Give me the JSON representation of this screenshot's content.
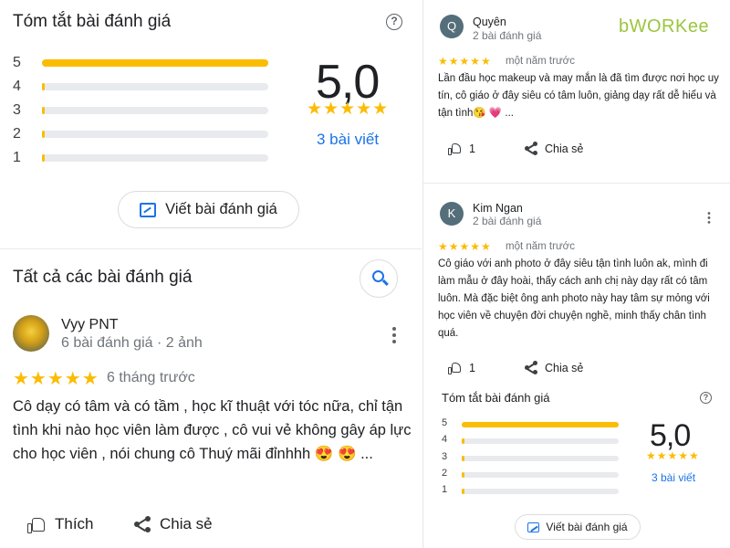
{
  "left": {
    "summary": {
      "title": "Tóm tắt bài đánh giá",
      "bars": [
        {
          "label": "5",
          "fraction": 1.0
        },
        {
          "label": "4",
          "fraction": 0.0
        },
        {
          "label": "3",
          "fraction": 0.0
        },
        {
          "label": "2",
          "fraction": 0.0
        },
        {
          "label": "1",
          "fraction": 0.0
        }
      ],
      "score": "5,0",
      "stars": "★★★★★",
      "count": "3 bài viết",
      "write_label": "Viết bài đánh giá"
    },
    "all_reviews": {
      "title": "Tất cả các bài đánh giá"
    },
    "review": {
      "name": "Vyy PNT",
      "meta": "6 bài đánh giá · 2 ảnh",
      "stars": "★★★★★",
      "time": "6 tháng trước",
      "text": "Cô dạy có tâm và có tầm , học kĩ thuật với tóc nữa, chỉ tận tình khi nào học viên làm được , cô vui vẻ không gây áp lực cho học viên , nói chung cô Thuý mãi đỉnhhh 😍 😍 ...",
      "like_label": "Thích",
      "share_label": "Chia sẻ"
    }
  },
  "right": {
    "brand": "bWORKee",
    "reviews": [
      {
        "initial": "Q",
        "name": "Quyên",
        "meta": "2 bài đánh giá",
        "stars": "★★★★★",
        "time": "một năm trước",
        "text": "Lần đầu học makeup và may mắn là đã tìm được nơi học uy tín, cô giáo ở đây siêu có tâm luôn, giảng dạy rất dễ hiểu và tận tình😘 💗 ...",
        "likes": "1",
        "share_label": "Chia sẻ"
      },
      {
        "initial": "K",
        "name": "Kim Ngan",
        "meta": "2 bài đánh giá",
        "stars": "★★★★★",
        "time": "một năm trước",
        "text": "Cô giáo với anh photo ở đây siêu tận tình luôn ak, mình đi làm mẫu ở đây hoài, thấy cách anh chị này dạy rất có tâm luôn. Mà đặc biệt ông anh photo này hay tâm sự mỏng với học viên về chuyện đời chuyện nghề, minh thấy chân tình quá.",
        "likes": "1",
        "share_label": "Chia sẻ"
      }
    ],
    "summary": {
      "title": "Tóm tắt bài đánh giá",
      "bars": [
        {
          "label": "5",
          "fraction": 1.0
        },
        {
          "label": "4",
          "fraction": 0.0
        },
        {
          "label": "3",
          "fraction": 0.0
        },
        {
          "label": "2",
          "fraction": 0.0
        },
        {
          "label": "1",
          "fraction": 0.0
        }
      ],
      "score": "5,0",
      "stars": "★★★★★",
      "count": "3 bài viết",
      "write_label": "Viết bài đánh giá"
    }
  },
  "colors": {
    "star": "#fbbc04",
    "link": "#1a73e8",
    "track": "#e8eaed",
    "brand": "#9bc53d"
  },
  "icons": [
    "help-icon",
    "edit-review-icon",
    "search-icon",
    "more-vert-icon",
    "thumb-up-icon",
    "share-icon"
  ]
}
